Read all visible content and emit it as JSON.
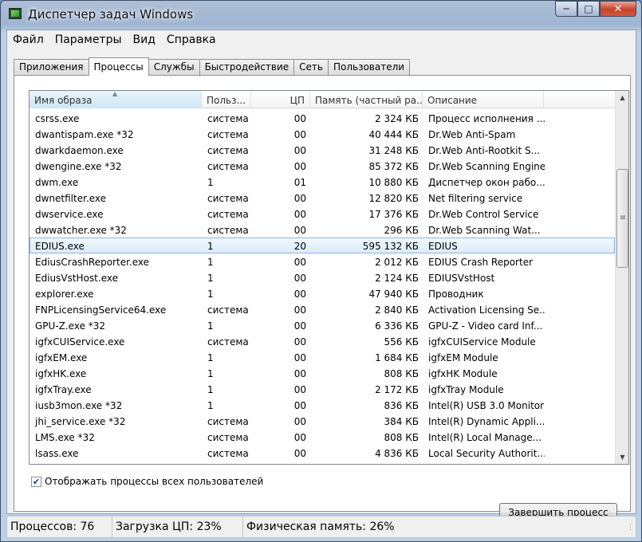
{
  "window": {
    "title": "Диспетчер задач Windows",
    "minimize_icon": "minimize-icon",
    "maximize_icon": "maximize-icon",
    "close_icon": "close-icon"
  },
  "menu": [
    "Файл",
    "Параметры",
    "Вид",
    "Справка"
  ],
  "tabs": [
    "Приложения",
    "Процессы",
    "Службы",
    "Быстродействие",
    "Сеть",
    "Пользователи"
  ],
  "active_tab": "Процессы",
  "columns": [
    "Имя образа",
    "Польз...",
    "ЦП",
    "Память (частный ра...",
    "Описание"
  ],
  "sorted_column": "Имя образа",
  "processes": [
    {
      "name": "csrss.exe",
      "user": "система",
      "cpu": "00",
      "mem": "2 324 КБ",
      "desc": "Процесс исполнения ..."
    },
    {
      "name": "dwantispam.exe *32",
      "user": "система",
      "cpu": "00",
      "mem": "40 444 КБ",
      "desc": "Dr.Web Anti-Spam"
    },
    {
      "name": "dwarkdaemon.exe",
      "user": "система",
      "cpu": "00",
      "mem": "31 248 КБ",
      "desc": "Dr.Web Anti-Rootkit S..."
    },
    {
      "name": "dwengine.exe *32",
      "user": "система",
      "cpu": "00",
      "mem": "85 372 КБ",
      "desc": "Dr.Web Scanning Engine"
    },
    {
      "name": "dwm.exe",
      "user": "1",
      "cpu": "01",
      "mem": "10 880 КБ",
      "desc": "Диспетчер окон рабо..."
    },
    {
      "name": "dwnetfilter.exe",
      "user": "система",
      "cpu": "00",
      "mem": "12 820 КБ",
      "desc": "Net filtering service"
    },
    {
      "name": "dwservice.exe",
      "user": "система",
      "cpu": "00",
      "mem": "17 376 КБ",
      "desc": "Dr.Web Control Service"
    },
    {
      "name": "dwwatcher.exe *32",
      "user": "система",
      "cpu": "00",
      "mem": "296 КБ",
      "desc": "Dr.Web Scanning Wat..."
    },
    {
      "name": "EDIUS.exe",
      "user": "1",
      "cpu": "20",
      "mem": "595 132 КБ",
      "desc": "EDIUS",
      "selected": true
    },
    {
      "name": "EdiusCrashReporter.exe",
      "user": "1",
      "cpu": "00",
      "mem": "2 012 КБ",
      "desc": "EDIUS Crash Reporter"
    },
    {
      "name": "EdiusVstHost.exe",
      "user": "1",
      "cpu": "00",
      "mem": "2 124 КБ",
      "desc": "EDIUSVstHost"
    },
    {
      "name": "explorer.exe",
      "user": "1",
      "cpu": "00",
      "mem": "47 940 КБ",
      "desc": "Проводник"
    },
    {
      "name": "FNPLicensingService64.exe",
      "user": "система",
      "cpu": "00",
      "mem": "2 840 КБ",
      "desc": "Activation Licensing Se..."
    },
    {
      "name": "GPU-Z.exe *32",
      "user": "1",
      "cpu": "00",
      "mem": "6 336 КБ",
      "desc": "GPU-Z - Video card Inf..."
    },
    {
      "name": "igfxCUIService.exe",
      "user": "система",
      "cpu": "00",
      "mem": "556 КБ",
      "desc": "igfxCUIService Module"
    },
    {
      "name": "igfxEM.exe",
      "user": "1",
      "cpu": "00",
      "mem": "1 684 КБ",
      "desc": "igfxEM Module"
    },
    {
      "name": "igfxHK.exe",
      "user": "1",
      "cpu": "00",
      "mem": "808 КБ",
      "desc": "igfxHK Module"
    },
    {
      "name": "igfxTray.exe",
      "user": "1",
      "cpu": "00",
      "mem": "2 172 КБ",
      "desc": "igfxTray Module"
    },
    {
      "name": "iusb3mon.exe *32",
      "user": "1",
      "cpu": "00",
      "mem": "836 КБ",
      "desc": "Intel(R) USB 3.0 Monitor"
    },
    {
      "name": "jhi_service.exe *32",
      "user": "система",
      "cpu": "00",
      "mem": "384 КБ",
      "desc": "Intel(R) Dynamic Appli..."
    },
    {
      "name": "LMS.exe *32",
      "user": "система",
      "cpu": "00",
      "mem": "808 КБ",
      "desc": "Intel(R) Local Manage..."
    },
    {
      "name": "lsass.exe",
      "user": "система",
      "cpu": "00",
      "mem": "4 836 КБ",
      "desc": "Local Security Authorit..."
    }
  ],
  "show_all_users": {
    "label": "Отображать процессы всех пользователей",
    "checked": true
  },
  "end_process_label": "Завершить процесс",
  "status": {
    "processes": "Процессов: 76",
    "cpu_load": "Загрузка ЦП: 23%",
    "physical_memory": "Физическая память: 26%"
  }
}
